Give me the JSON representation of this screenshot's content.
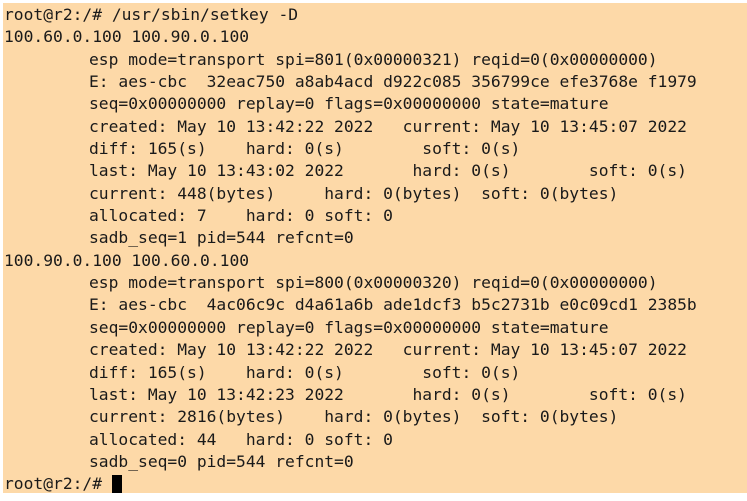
{
  "terminal": {
    "prompt_command": "root@r2:/# /usr/sbin/setkey -D",
    "sa1": {
      "header": "100.60.0.100 100.90.0.100",
      "lines": [
        "esp mode=transport spi=801(0x00000321) reqid=0(0x00000000)",
        "E: aes-cbc  32eac750 a8ab4acd d922c085 356799ce efe3768e f1979",
        "seq=0x00000000 replay=0 flags=0x00000000 state=mature",
        "created: May 10 13:42:22 2022   current: May 10 13:45:07 2022",
        "diff: 165(s)    hard: 0(s)        soft: 0(s)",
        "last: May 10 13:43:02 2022       hard: 0(s)        soft: 0(s)",
        "current: 448(bytes)     hard: 0(bytes)  soft: 0(bytes)",
        "allocated: 7    hard: 0 soft: 0",
        "sadb_seq=1 pid=544 refcnt=0"
      ]
    },
    "sa2": {
      "header": "100.90.0.100 100.60.0.100",
      "lines": [
        "esp mode=transport spi=800(0x00000320) reqid=0(0x00000000)",
        "E: aes-cbc  4ac06c9c d4a61a6b ade1dcf3 b5c2731b e0c09cd1 2385b",
        "seq=0x00000000 replay=0 flags=0x00000000 state=mature",
        "created: May 10 13:42:22 2022   current: May 10 13:45:07 2022",
        "diff: 165(s)    hard: 0(s)        soft: 0(s)",
        "last: May 10 13:42:23 2022       hard: 0(s)        soft: 0(s)",
        "current: 2816(bytes)    hard: 0(bytes)  soft: 0(bytes)",
        "allocated: 44   hard: 0 soft: 0",
        "sadb_seq=0 pid=544 refcnt=0"
      ]
    },
    "final_prompt": "root@r2:/#",
    "colors": {
      "background": "#fdd9a8",
      "text": "#1a1a1a",
      "cursor": "#000000"
    }
  }
}
